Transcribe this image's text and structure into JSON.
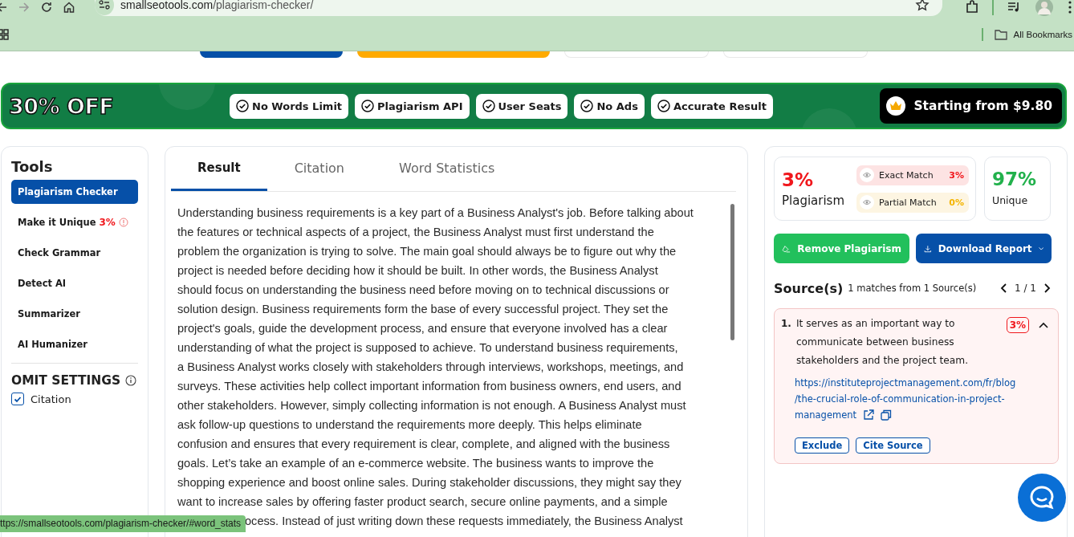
{
  "browser": {
    "url_host": "smallseotools.com",
    "url_path": "/plagiarism-checker/",
    "bookmarks_label": "All Bookmarks"
  },
  "top_buttons": [
    {
      "kind": "filled",
      "color": "#0650a8"
    },
    {
      "kind": "filled",
      "color": "#ffaa00"
    },
    {
      "kind": "outline",
      "color": "#e8e8e8"
    },
    {
      "kind": "outline",
      "color": "#e8e8e8"
    }
  ],
  "promo": {
    "discount": "30% OFF",
    "features": [
      "No Words Limit",
      "Plagiarism API",
      "User Seats",
      "No Ads",
      "Accurate Result"
    ],
    "price": "Starting from $9.80"
  },
  "sidebar": {
    "title": "Tools",
    "items": [
      {
        "label": "Plagiarism Checker",
        "selected": true
      },
      {
        "label": "Make it Unique",
        "badge": "3%",
        "selected": false
      },
      {
        "label": "Check Grammar",
        "selected": false
      },
      {
        "label": "Detect AI",
        "selected": false
      },
      {
        "label": "Summarizer",
        "selected": false
      },
      {
        "label": "AI Humanizer",
        "selected": false
      }
    ],
    "omit_title": "OMIT SETTINGS",
    "options": [
      {
        "label": "Citation",
        "checked": true
      }
    ]
  },
  "tabs": [
    {
      "label": "Result",
      "selected": true
    },
    {
      "label": "Citation",
      "selected": false
    },
    {
      "label": "Word Statistics",
      "selected": false
    }
  ],
  "body_lines": [
    "Understanding business requirements is a key part of a Business Analyst's job. Before talking about",
    "the features or technical aspects of a project, the Business Analyst must first understand the",
    "problem the organization is trying to solve. The main goal should always be to figure out why the",
    "project is needed before deciding how it should be built. In other words, the Business Analyst",
    "should focus on understanding the business need before moving on to technical discussions or",
    "solution design. Business requirements form the base of every successful project. They set the",
    "project's goals, guide the development process, and ensure that everyone involved has a clear",
    "understanding of what the project is supposed to achieve. To understand business requirements,",
    "a Business Analyst works closely with stakeholders through interviews, workshops, meetings, and",
    "surveys. These activities help collect important information from business owners, end users, and",
    "other stakeholders. However, simply collecting information is not enough. A Business Analyst must",
    "ask follow-up questions to understand the requirements more deeply. This helps eliminate",
    "confusion and ensures that every requirement is clear, complete, and aligned with the business",
    "goals. Let’s take an example of an e-commerce website. The business wants to improve the",
    "shopping experience and boost online sales. During stakeholder discussions, they might say they",
    "want to increase sales by offering faster product search, secure online payments, and a simple"
  ],
  "body_partial_line": "ocess. Instead of just writing down these requests immediately, the Business Analyst",
  "summary": {
    "plagiarism_value": "3%",
    "plagiarism_label": "Plagiarism",
    "matches": [
      {
        "kind": "exact",
        "label": "Exact Match",
        "value": "3%"
      },
      {
        "kind": "partial",
        "label": "Partial Match",
        "value": "0%"
      }
    ],
    "unique_value": "97%",
    "unique_label": "Unique"
  },
  "actions": {
    "remove": "Remove Plagiarism",
    "download": "Download Report"
  },
  "sources": {
    "title": "Source(s)",
    "subtitle": "1 matches from 1 Source(s)",
    "pager": "1 / 1",
    "items": [
      {
        "number": "1.",
        "text": "It serves as an important way to communicate between business stakeholders and the project team.",
        "percent": "3%",
        "expanded": true,
        "url_lines": [
          "https://instituteprojectmanagement.com/fr/blog",
          "/the-crucial-role-of-communication-in-project-",
          "management"
        ],
        "buttons": [
          "Exclude",
          "Cite Source"
        ]
      }
    ]
  },
  "status_url": "ttps://smallseotools.com/plagiarism-checker/#word_stats"
}
